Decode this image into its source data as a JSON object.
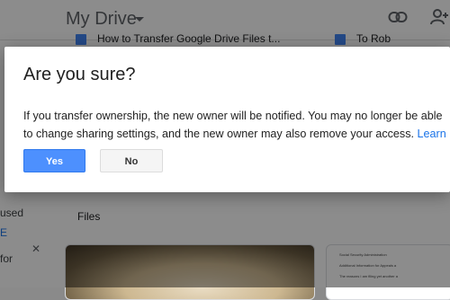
{
  "background": {
    "drive_title": "My Drive",
    "quick_access": [
      "How to Transfer Google Drive Files t...",
      "To Rob"
    ],
    "sidebar": {
      "used_text": "used",
      "link_text": "E",
      "for_text": "for"
    },
    "files_heading": "Files",
    "doc_preview_lines": [
      "Social Security Administration",
      "Additional Information for Appeals a",
      "The reasons I am filing yet another a"
    ]
  },
  "dialog": {
    "title": "Are you sure?",
    "message": "If you transfer ownership, the new owner will be notified. You may no longer be able to change sharing settings, and the new owner may also remove your access.",
    "learn_more": "Learn more",
    "yes_label": "Yes",
    "no_label": "No"
  },
  "colors": {
    "primary_button": "#4d90fe",
    "link": "#1a73e8",
    "overlay": "rgba(0,0,0,0.45)"
  },
  "icons": [
    "link-icon",
    "add-person-icon",
    "doc-icon",
    "close-icon",
    "caret-down-icon"
  ]
}
